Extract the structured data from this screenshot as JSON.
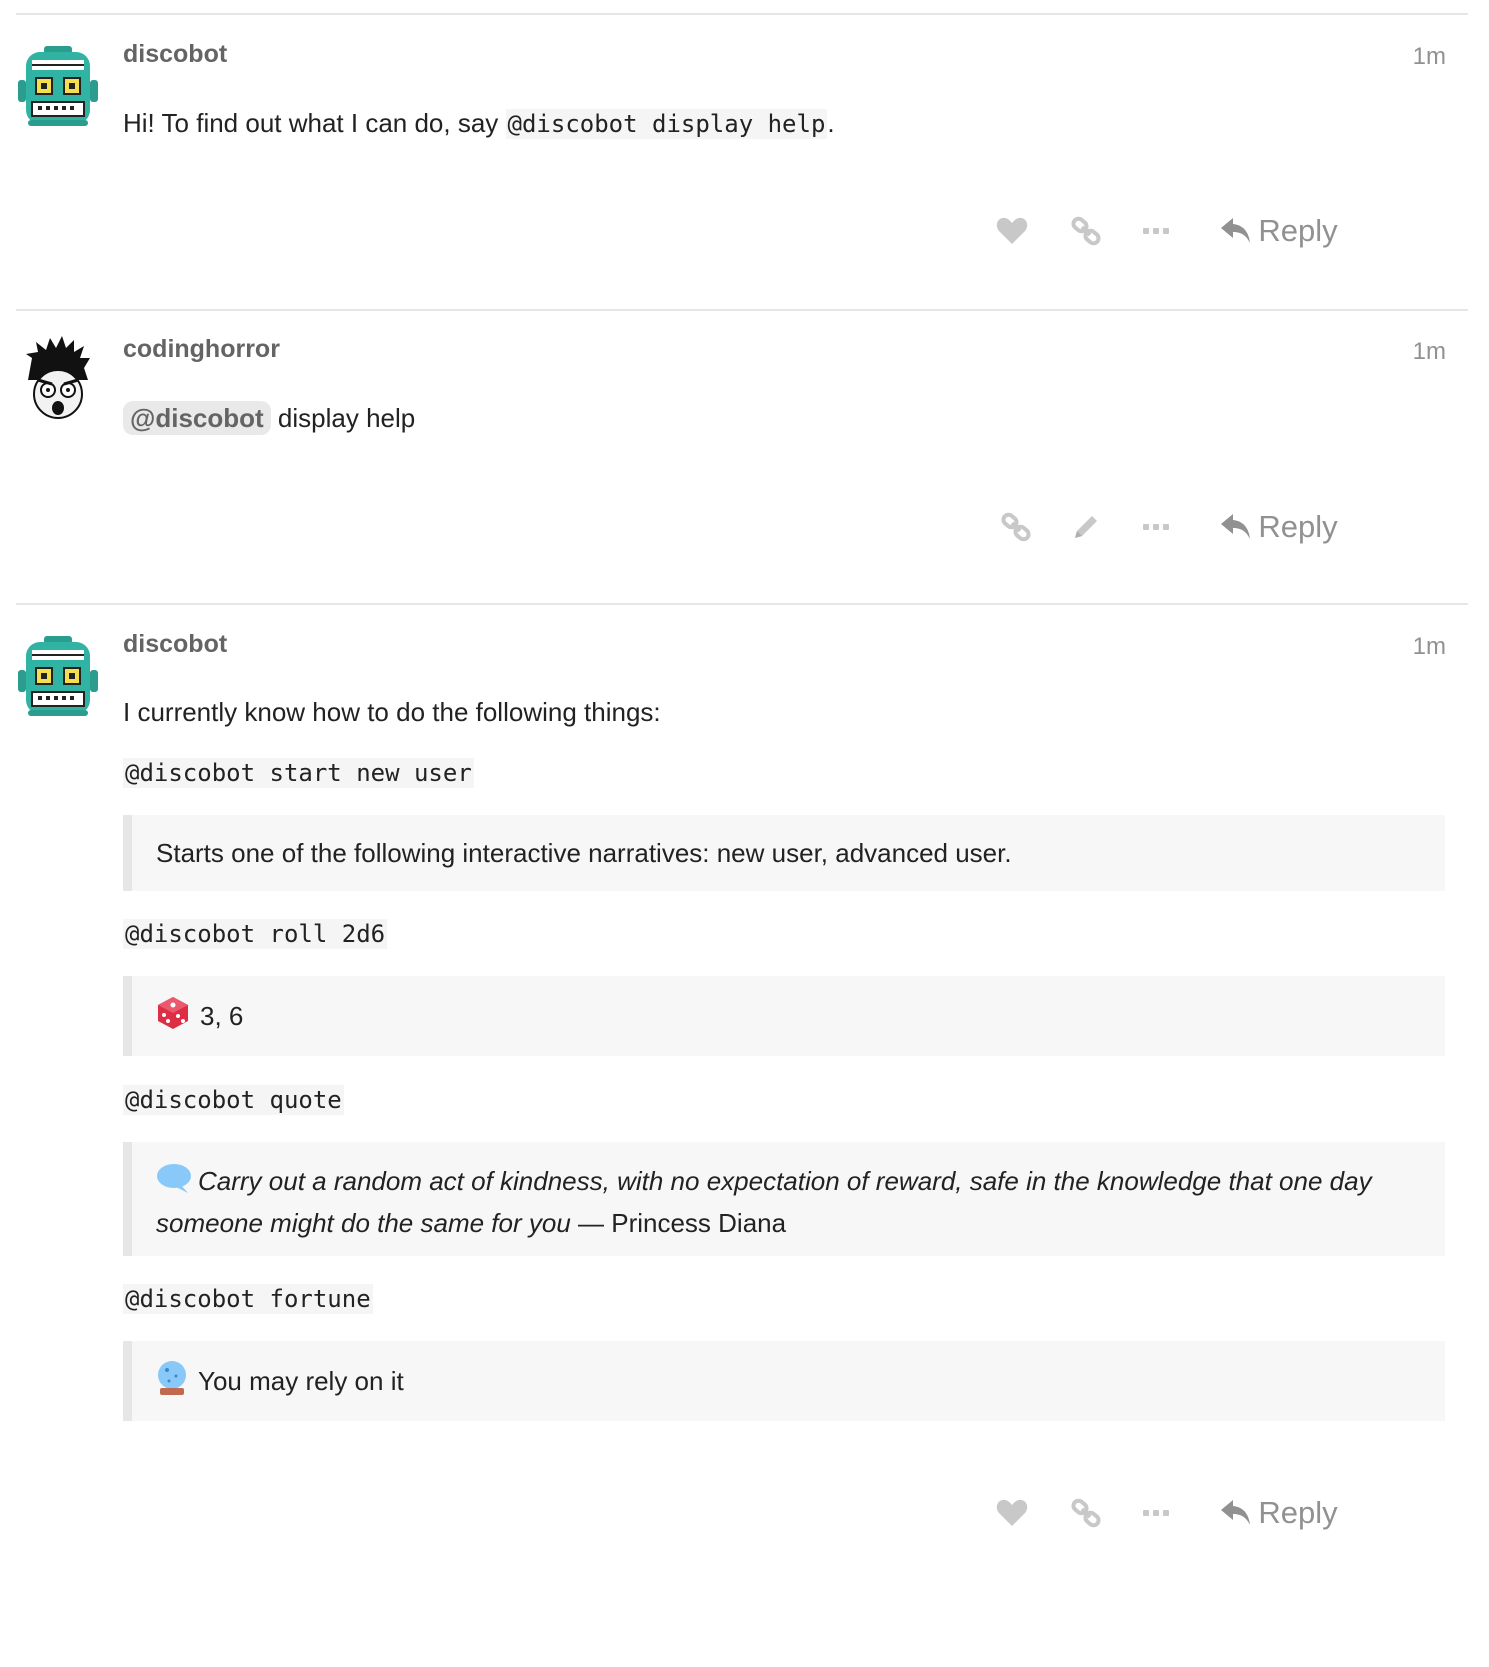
{
  "posts": [
    {
      "username": "discobot",
      "age": "1m",
      "text_before": "Hi! To find out what I can do, say ",
      "code": "@discobot display help",
      "text_after": ".",
      "reply_label": "Reply"
    },
    {
      "username": "codinghorror",
      "age": "1m",
      "mention": "@discobot",
      "text": " display help",
      "reply_label": "Reply"
    },
    {
      "username": "discobot",
      "age": "1m",
      "intro": "I currently know how to do the following things:",
      "commands": [
        {
          "cmd": "@discobot start new user",
          "result": "Starts one of the following interactive narratives: new user, advanced user."
        },
        {
          "cmd": "@discobot roll 2d6",
          "result": "3, 6"
        },
        {
          "cmd": "@discobot quote",
          "quote_line1": "Carry out a random act of kindness, with no expectation of reward, safe in the knowledge that one day",
          "quote_line2": "someone might do the same for you",
          "quote_author": " — Princess Diana"
        },
        {
          "cmd": "@discobot fortune",
          "result": "You may rely on it"
        }
      ],
      "reply_label": "Reply"
    }
  ]
}
